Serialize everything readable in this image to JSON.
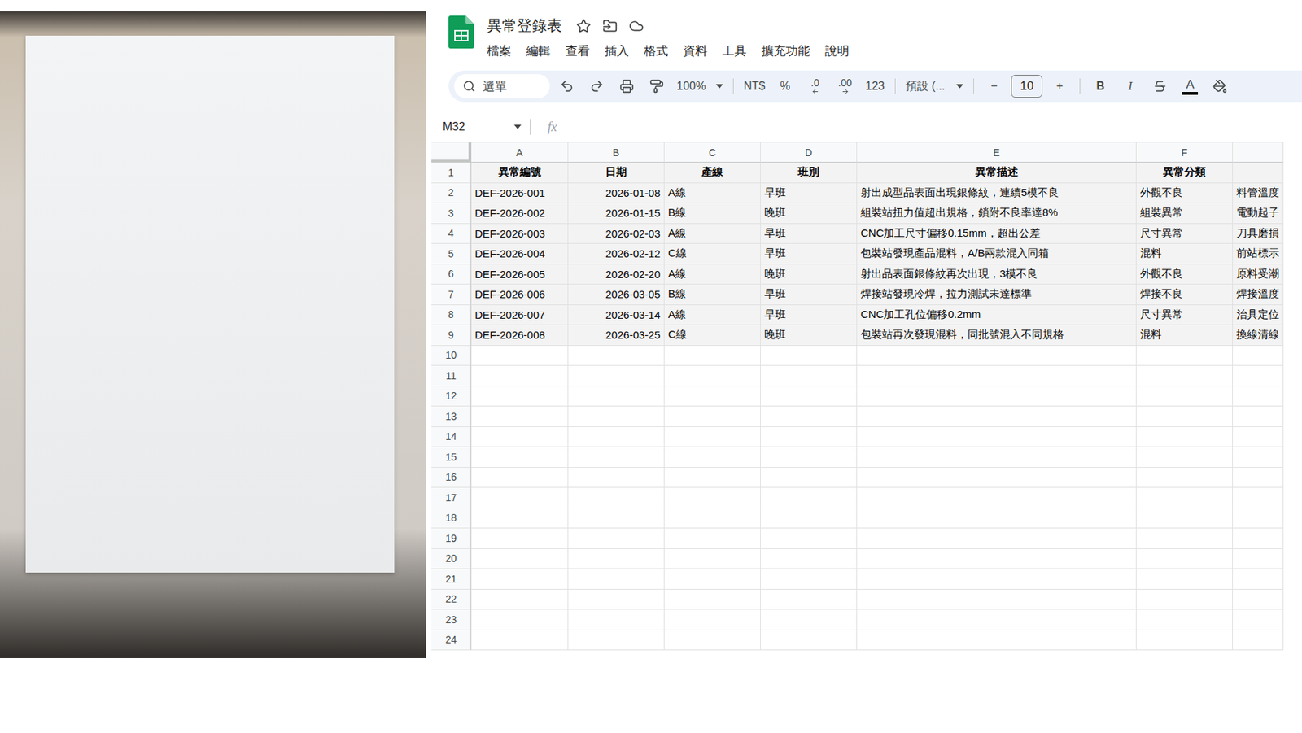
{
  "window": {
    "title": "異常登錄表"
  },
  "menu": [
    "檔案",
    "編輯",
    "查看",
    "插入",
    "格式",
    "資料",
    "工具",
    "擴充功能",
    "說明"
  ],
  "toolbar": {
    "search": "選單",
    "zoom": "100%",
    "number_formats": [
      "NT$",
      "%",
      ".0",
      ".00",
      "123"
    ],
    "font": "預設 (...",
    "font_size": {
      "minus": "−",
      "value": "10",
      "plus": "+"
    },
    "styles": [
      "B",
      "I"
    ],
    "text_color": "A"
  },
  "formula_bar": {
    "cell": "M32",
    "fx": "fx",
    "value": ""
  },
  "sheet": {
    "columns": [
      "A",
      "B",
      "C",
      "D",
      "E",
      "F",
      ""
    ],
    "rows": [
      {
        "number": "1",
        "kind": "header",
        "cells": [
          "異常編號",
          "日期",
          "產線",
          "班別",
          "異常描述",
          "異常分類",
          ""
        ]
      },
      {
        "number": "2",
        "kind": "data",
        "cells": [
          "DEF-2026-001",
          "2026-01-08",
          "A線",
          "早班",
          "射出成型品表面出現銀條紋，連續5模不良",
          "外觀不良",
          "料管溫度"
        ]
      },
      {
        "number": "3",
        "kind": "data",
        "cells": [
          "DEF-2026-002",
          "2026-01-15",
          "B線",
          "晚班",
          "組裝站扭力值超出規格，鎖附不良率達8%",
          "組裝異常",
          "電動起子"
        ]
      },
      {
        "number": "4",
        "kind": "data",
        "cells": [
          "DEF-2026-003",
          "2026-02-03",
          "A線",
          "早班",
          "CNC加工尺寸偏移0.15mm，超出公差",
          "尺寸異常",
          "刀具磨損"
        ]
      },
      {
        "number": "5",
        "kind": "data",
        "cells": [
          "DEF-2026-004",
          "2026-02-12",
          "C線",
          "早班",
          "包裝站發現產品混料，A/B兩款混入同箱",
          "混料",
          "前站標示"
        ]
      },
      {
        "number": "6",
        "kind": "data",
        "cells": [
          "DEF-2026-005",
          "2026-02-20",
          "A線",
          "晚班",
          "射出品表面銀條紋再次出現，3模不良",
          "外觀不良",
          "原料受潮"
        ]
      },
      {
        "number": "7",
        "kind": "data",
        "cells": [
          "DEF-2026-006",
          "2026-03-05",
          "B線",
          "早班",
          "焊接站發現冷焊，拉力測試未達標準",
          "焊接不良",
          "焊接溫度"
        ]
      },
      {
        "number": "8",
        "kind": "data",
        "cells": [
          "DEF-2026-007",
          "2026-03-14",
          "A線",
          "早班",
          "CNC加工孔位偏移0.2mm",
          "尺寸異常",
          "治具定位"
        ]
      },
      {
        "number": "9",
        "kind": "data",
        "cells": [
          "DEF-2026-008",
          "2026-03-25",
          "C線",
          "晚班",
          "包裝站再次發現混料，同批號混入不同規格",
          "混料",
          "換線清線"
        ]
      },
      {
        "number": "10",
        "kind": "empty",
        "cells": []
      },
      {
        "number": "11",
        "kind": "empty",
        "cells": []
      },
      {
        "number": "12",
        "kind": "empty",
        "cells": []
      },
      {
        "number": "13",
        "kind": "empty",
        "cells": []
      },
      {
        "number": "14",
        "kind": "empty",
        "cells": []
      },
      {
        "number": "15",
        "kind": "empty",
        "cells": []
      },
      {
        "number": "16",
        "kind": "empty",
        "cells": []
      },
      {
        "number": "17",
        "kind": "empty",
        "cells": []
      },
      {
        "number": "18",
        "kind": "empty",
        "cells": []
      },
      {
        "number": "19",
        "kind": "empty",
        "cells": []
      },
      {
        "number": "20",
        "kind": "empty",
        "cells": []
      },
      {
        "number": "21",
        "kind": "empty",
        "cells": []
      },
      {
        "number": "22",
        "kind": "empty",
        "cells": []
      },
      {
        "number": "23",
        "kind": "empty",
        "cells": []
      },
      {
        "number": "24",
        "kind": "empty",
        "cells": []
      }
    ]
  }
}
